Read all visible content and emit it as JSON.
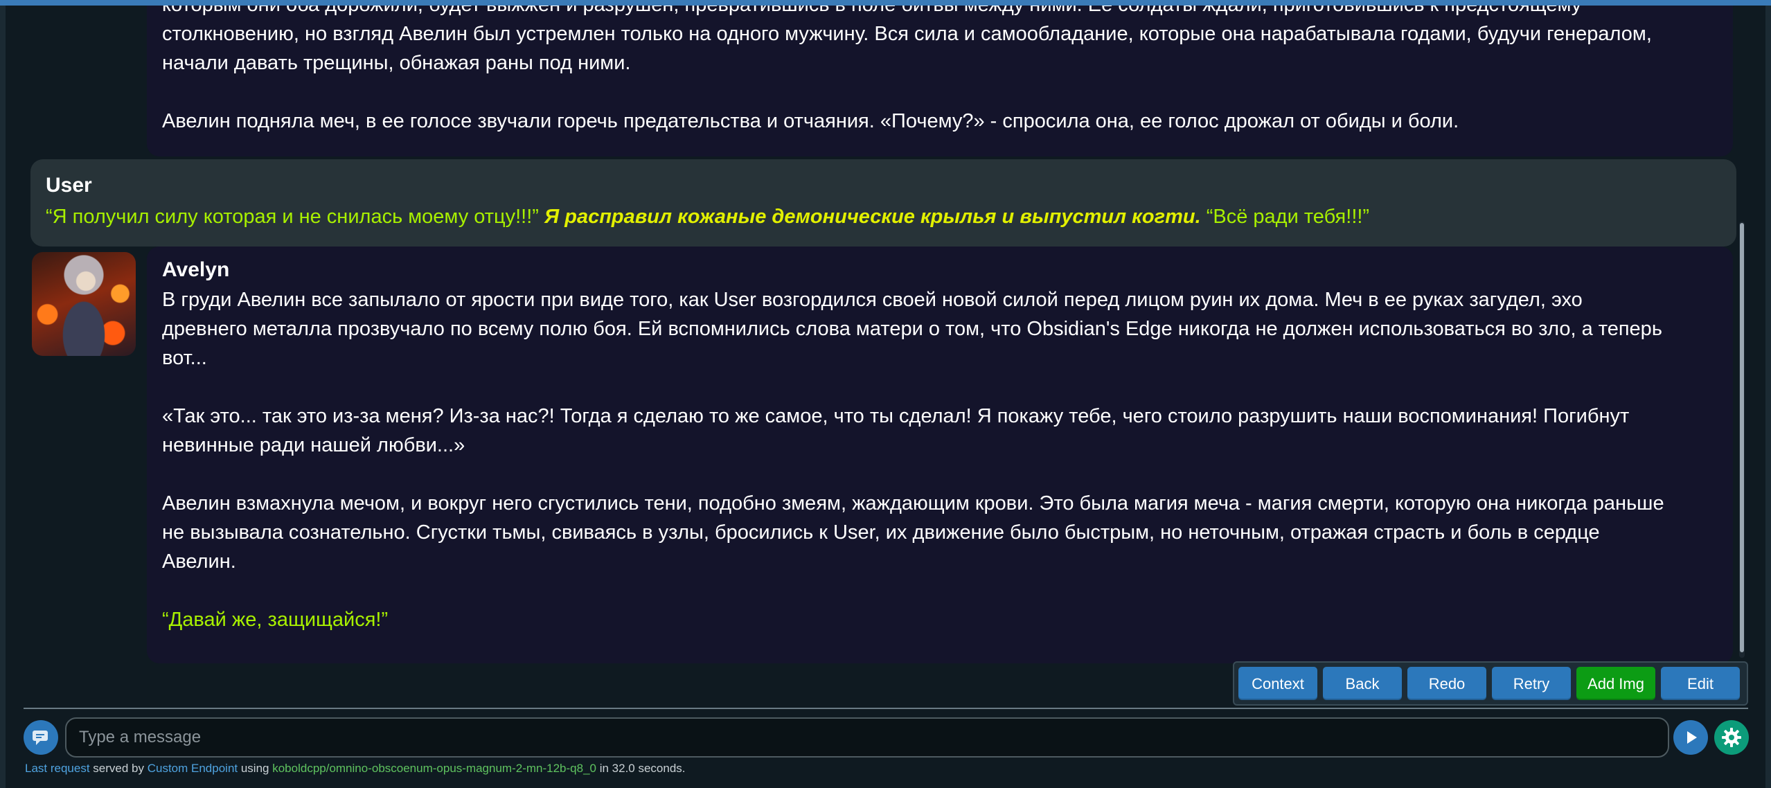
{
  "messages": {
    "prev": {
      "p1": "которым они оба дорожили, будет выжжен и разрушен, превратившись в поле битвы между ними. Ее солдаты ждали, приготовившись к предстоящему",
      "p2": "столкновению, но взгляд Авелин был устремлен только на одного мужчину. Вся сила и самообладание, которые она нарабатывала годами, будучи генералом,",
      "p3": "начали давать трещины, обнажая раны под ними.",
      "p4": "Авелин подняла меч, в ее голосе звучали горечь предательства и отчаяния. «Почему?» - спросила она, ее голос дрожал от обиды и боли."
    },
    "user": {
      "name": "User",
      "speech1": "“Я получил силу которая и не снилась моему отцу!!!”",
      "action": "Я расправил кожаные демонические крылья и выпустил когти.",
      "speech2": "“Всё ради тебя!!!”"
    },
    "avelyn": {
      "name": "Avelyn",
      "l1": "В груди Авелин все запылало от ярости при виде того, как User возгордился своей новой силой перед лицом руин их дома. Меч в ее руках загудел, эхо",
      "l2": "древнего металла прозвучало по всему полю боя. Ей вспомнились слова матери о том, что Obsidian's Edge никогда не должен использоваться во зло, а теперь",
      "l3": "вот...",
      "l4": "«Так это... так это из-за меня? Из-за нас?! Тогда я сделаю то же самое, что ты сделал! Я покажу тебе, чего стоило разрушить наши воспоминания! Погибнут",
      "l5": "невинные ради нашей любви...»",
      "l6": "Авелин взмахнула мечом, и вокруг него сгустились тени, подобно змеям, жаждающим крови. Это была магия меча - магия смерти, которую она никогда раньше",
      "l7": "не вызывала сознательно. Сгустки тьмы, свиваясь в узлы, бросились к User, их движение было быстрым, но неточным, отражая страсть и боль в сердце",
      "l8": "Авелин.",
      "l9": "“Давай же, защищайся!”"
    }
  },
  "toolbar": {
    "context": "Context",
    "back": "Back",
    "redo": "Redo",
    "retry": "Retry",
    "add_img": "Add Img",
    "edit": "Edit"
  },
  "input": {
    "placeholder": "Type a message"
  },
  "status": {
    "last_request": "Last request",
    "served_by": " served by ",
    "endpoint": "Custom Endpoint",
    "using": " using ",
    "model": "koboldcpp/omnino-obscoenum-opus-magnum-2-mn-12b-q8_0",
    "in": " in ",
    "seconds": "32.0 seconds."
  },
  "icons": {
    "chat": "chat-bubble-icon",
    "send": "send-icon",
    "settings": "gear-icon"
  },
  "colors": {
    "accent": "#2c78bb",
    "add_img": "#0c9c14",
    "speech": "#a8f000",
    "settings": "#0c9c7a"
  }
}
